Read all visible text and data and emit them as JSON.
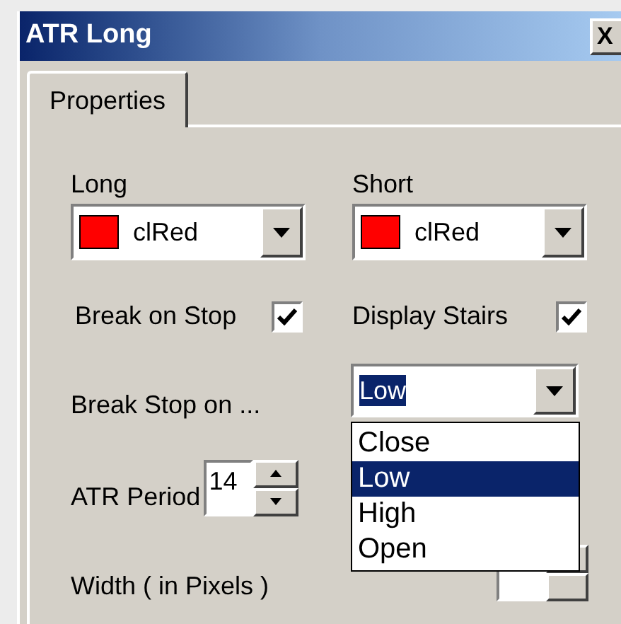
{
  "window": {
    "title": "ATR Long",
    "close": "X"
  },
  "tabs": [
    {
      "label": "Properties",
      "selected": true
    }
  ],
  "color_fields": [
    {
      "label": "Long",
      "value": "clRed",
      "color": "#ff0000"
    },
    {
      "label": "Short",
      "value": "clRed",
      "color": "#ff0000"
    }
  ],
  "checkboxes": [
    {
      "label": "Break on Stop",
      "checked": true
    },
    {
      "label": "Display Stairs",
      "checked": true
    }
  ],
  "break_stop": {
    "label": "Break Stop on ...",
    "value": "Low",
    "expanded": true,
    "options": [
      {
        "label": "Close",
        "selected": false
      },
      {
        "label": "Low",
        "selected": true
      },
      {
        "label": "High",
        "selected": false
      },
      {
        "label": "Open",
        "selected": false
      }
    ]
  },
  "atr_period": {
    "label": "ATR Period",
    "value": "14"
  },
  "width": {
    "label": "Width ( in Pixels )"
  }
}
